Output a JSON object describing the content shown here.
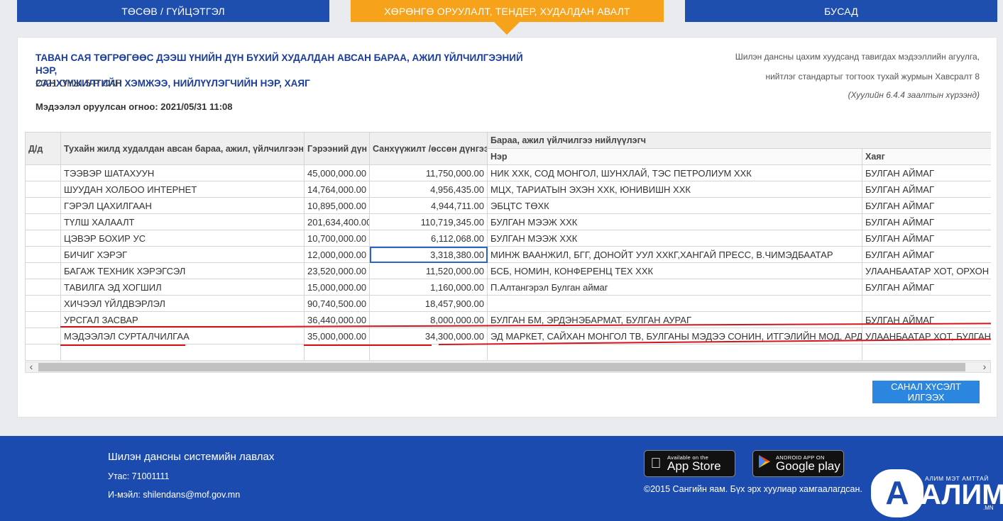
{
  "tabs": [
    {
      "label": "Төсөв / гүйцэтгэл"
    },
    {
      "label": "Хөрөнгө оруулалт, тендер, худалдан авалт"
    },
    {
      "label": "Бусад"
    }
  ],
  "report": {
    "title_line1": "ТАВАН САЯ ТӨГРӨГӨӨС ДЭЭШ ҮНИЙН ДҮН БҮХИЙ ХУДАЛДАН АВСАН БАРАА, АЖИЛ ҮЙЛЧИЛГЭЭНИЙ НЭР,",
    "title_line2": "САНХҮҮЖИЛТИЙН ХЭМЖЭЭ, НИЙЛҮҮЛЭГЧИЙН НЭР, ХАЯГ",
    "subtitle": "2021 ОНЫ 5-Р САР",
    "date_line": "Мэдээлэл оруулсан огноо: 2021/05/31 11:08",
    "legal_line1": "Шилэн дансны цахим хуудсанд тавигдах мэдээллийн агуулга,",
    "legal_line2": "нийтлэг стандартыг тогтоох тухай журмын Хавсралт 8",
    "legal_line3": "(Хуулийн 6.4.4 заалтын хүрээнд)"
  },
  "table": {
    "headers": {
      "index": "Д/д",
      "name": "Тухайн жилд худалдан авсан бараа, ажил, үйлчилгээний нэр",
      "contract": "Гэрээний дүн",
      "funding": "Санхүүжилт /өссөн дүнгээр/",
      "supplier_group": "Бараа, ажил үйлчилгээ нийлүүлэгч",
      "supplier_name": "Нэр",
      "supplier_address": "Хаяг"
    },
    "rows": [
      {
        "index": "",
        "name": "ТЭЭВЭР ШАТАХУУН",
        "contract": "45,000,000.00",
        "funding": "11,750,000.00",
        "supplier": "НИК ХХК, СОД МОНГОЛ, ШУНХЛАЙ, ТЭС ПЕТРОЛИУМ ХХК",
        "address": "БУЛГАН АЙМАГ"
      },
      {
        "index": "",
        "name": "ШУУДАН ХОЛБОО ИНТЕРНЕТ",
        "contract": "14,764,000.00",
        "funding": "4,956,435.00",
        "supplier": "МЦХ, ТАРИАТЫН ЭХЭН ХХК, ЮНИВИШН ХХК",
        "address": "БУЛГАН АЙМАГ"
      },
      {
        "index": "",
        "name": "ГЭРЭЛ ЦАХИЛГААН",
        "contract": "10,895,000.00",
        "funding": "4,944,711.00",
        "supplier": "ЭБЦТС ТӨХК",
        "address": "БУЛГАН АЙМАГ"
      },
      {
        "index": "",
        "name": "ТҮЛШ ХАЛААЛТ",
        "contract": "201,634,400.00",
        "funding": "110,719,345.00",
        "supplier": "БУЛГАН МЭЭЖ ХХК",
        "address": "БУЛГАН АЙМАГ"
      },
      {
        "index": "",
        "name": "ЦЭВЭР БОХИР УС",
        "contract": "10,700,000.00",
        "funding": "6,112,068.00",
        "supplier": "БУЛГАН МЭЭЖ ХХК",
        "address": "БУЛГАН АЙМАГ"
      },
      {
        "index": "",
        "name": "БИЧИГ ХЭРЭГ",
        "contract": "12,000,000.00",
        "funding": "3,318,380.00",
        "supplier": "МИНЖ ВААНЖИЛ, БГГ, ДОНОЙТ УУЛ ХХКГ,ХАНГАЙ ПРЕСС, В.ЧИМЭДБААТАР",
        "address": "БУЛГАН АЙМАГ"
      },
      {
        "index": "",
        "name": "БАГАЖ ТЕХНИК ХЭРЭГСЭЛ",
        "contract": "23,520,000.00",
        "funding": "11,520,000.00",
        "supplier": "БСБ, НОМИН, КОНФЕРЕНЦ ТЕХ ХХК",
        "address": "УЛААНБААТАР ХОТ, ОРХОН АЙМАГ"
      },
      {
        "index": "",
        "name": "ТАВИЛГА ЭД ХОГШИЛ",
        "contract": "15,000,000.00",
        "funding": "1,160,000.00",
        "supplier": "П.Алтангэрэл Булган аймаг",
        "address": "БУЛГАН АЙМАГ"
      },
      {
        "index": "",
        "name": "ХИЧЭЭЛ ҮЙЛДВЭРЛЭЛ",
        "contract": "90,740,500.00",
        "funding": "18,457,900.00",
        "supplier": "",
        "address": ""
      },
      {
        "index": "",
        "name": "УРСГАЛ ЗАСВАР",
        "contract": "36,440,000.00",
        "funding": "8,000,000.00",
        "supplier": "БУЛГАН БМ, ЭРДЭНЭБАРМАТ, БУЛГАН АУРАГ",
        "address": "БУЛГАН АЙМАГ"
      },
      {
        "index": "",
        "name": "МЭДЭЭЛЭЛ СУРТАЛЧИЛГАА",
        "contract": "35,000,000.00",
        "funding": "34,300,000.00",
        "supplier": "ЭД МАРКЕТ, САЙХАН МОНГОЛ ТВ, БУЛГАНЫ МЭДЭЭ СОНИН, ИТГЭЛИЙН МОД, АРДЧИЛАЛ СОНИН",
        "address": "УЛААНБААТАР ХОТ, БУЛГАН АЙМАГ"
      },
      {
        "index": "",
        "name": "",
        "contract": "",
        "funding": "",
        "supplier": "",
        "address": ""
      }
    ]
  },
  "actions": {
    "submit_label": "Санал хүсэлт илгээх"
  },
  "footer": {
    "title": "Шилэн дансны системийн лавлах",
    "phone": "Утас: 71001111",
    "email": "И-мэйл: shilendans@mof.gov.mn",
    "app_store_small": "Available on the",
    "app_store_big": "App Store",
    "google_small": "ANDROID APP ON",
    "google_big": "Google play",
    "copyright": "©2015 Сангийн яам. Бүх эрх хуулиар хамгаалагдсан.",
    "brand_tag": "АЛИМ МЭТ АМТТАЙ",
    "brand_letter": "А",
    "brand_word": "АЛИМ",
    "brand_domain": ".MN"
  }
}
